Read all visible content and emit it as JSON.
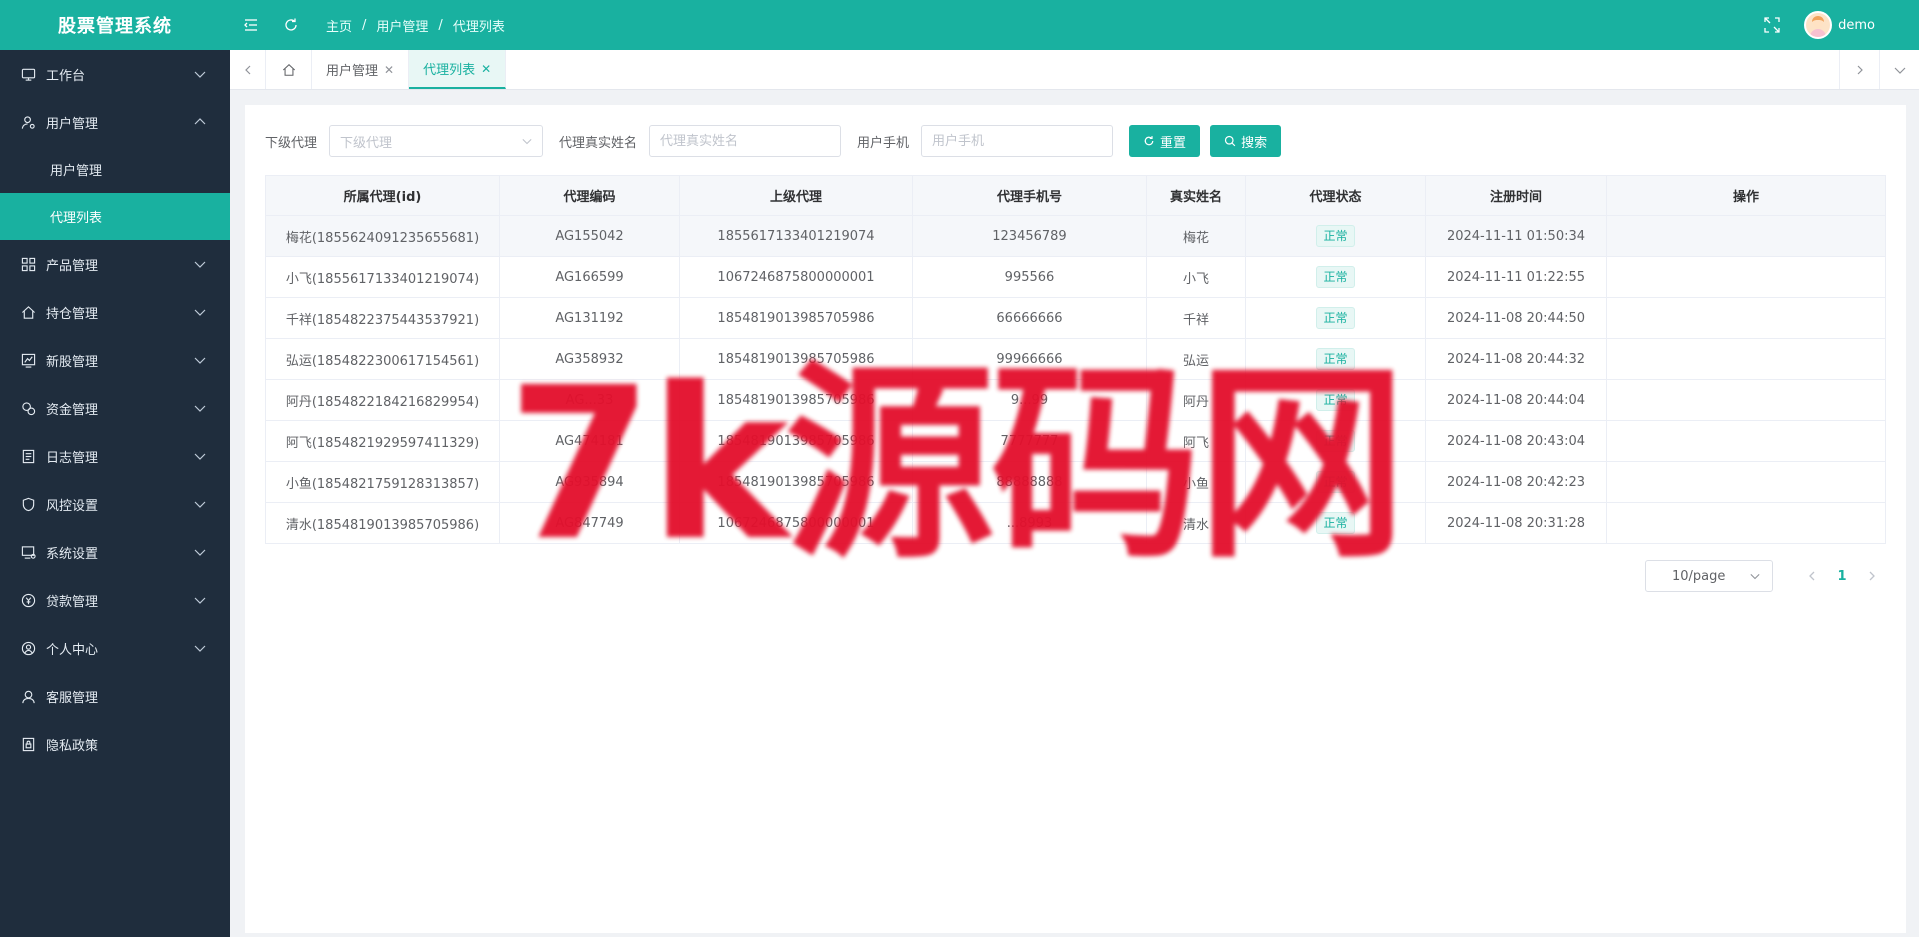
{
  "header": {
    "logo": "股票管理系统",
    "breadcrumb": [
      "主页",
      "用户管理",
      "代理列表"
    ],
    "username": "demo"
  },
  "sidebar": {
    "items": [
      {
        "label": "工作台",
        "icon": "monitor-icon",
        "expanded": false
      },
      {
        "label": "用户管理",
        "icon": "user-gear-icon",
        "expanded": true,
        "children": [
          {
            "label": "用户管理",
            "active": false
          },
          {
            "label": "代理列表",
            "active": true
          }
        ]
      },
      {
        "label": "产品管理",
        "icon": "grid-icon",
        "expanded": false
      },
      {
        "label": "持仓管理",
        "icon": "house-icon",
        "expanded": false
      },
      {
        "label": "新股管理",
        "icon": "chart-board-icon",
        "expanded": false
      },
      {
        "label": "资金管理",
        "icon": "money-icon",
        "expanded": false
      },
      {
        "label": "日志管理",
        "icon": "log-icon",
        "expanded": false
      },
      {
        "label": "风控设置",
        "icon": "shield-icon",
        "expanded": false
      },
      {
        "label": "系统设置",
        "icon": "settings-monitor-icon",
        "expanded": false
      },
      {
        "label": "贷款管理",
        "icon": "coin-icon",
        "expanded": false
      },
      {
        "label": "个人中心",
        "icon": "user-circle-icon",
        "expanded": false
      },
      {
        "label": "客服管理",
        "icon": "headset-icon",
        "hasArrow": false
      },
      {
        "label": "隐私政策",
        "icon": "lock-doc-icon",
        "hasArrow": false
      }
    ]
  },
  "tabs": [
    {
      "label": "用户管理",
      "active": false
    },
    {
      "label": "代理列表",
      "active": true
    }
  ],
  "filters": {
    "sub_agent_label": "下级代理",
    "sub_agent_placeholder": "下级代理",
    "real_name_label": "代理真实姓名",
    "real_name_placeholder": "代理真实姓名",
    "phone_label": "用户手机",
    "phone_placeholder": "用户手机",
    "reset_label": "重置",
    "search_label": "搜索"
  },
  "table": {
    "columns": [
      "所属代理(id)",
      "代理编码",
      "上级代理",
      "代理手机号",
      "真实姓名",
      "代理状态",
      "注册时间",
      "操作"
    ],
    "rows": [
      [
        "梅花(1855624091235655681)",
        "AG155042",
        "1855617133401219074",
        "123456789",
        "梅花",
        "正常",
        "2024-11-11 01:50:34",
        ""
      ],
      [
        "小飞(1855617133401219074)",
        "AG166599",
        "1067246875800000001",
        "995566",
        "小飞",
        "正常",
        "2024-11-11 01:22:55",
        ""
      ],
      [
        "千祥(1854822375443537921)",
        "AG131192",
        "1854819013985705986",
        "66666666",
        "千祥",
        "正常",
        "2024-11-08 20:44:50",
        ""
      ],
      [
        "弘运(1854822300617154561)",
        "AG358932",
        "1854819013985705986",
        "99966666",
        "弘运",
        "正常",
        "2024-11-08 20:44:32",
        ""
      ],
      [
        "阿丹(1854822184216829954)",
        "AG...33",
        "1854819013985705986",
        "9...99",
        "阿丹",
        "正常",
        "2024-11-08 20:44:04",
        ""
      ],
      [
        "阿飞(1854821929597411329)",
        "AG474181",
        "1854819013985705986",
        "7777777",
        "阿飞",
        "正常",
        "2024-11-08 20:43:04",
        ""
      ],
      [
        "小鱼(1854821759128313857)",
        "AG935894",
        "1854819013985705986",
        "88888888",
        "小鱼",
        "正常",
        "2024-11-08 20:42:23",
        ""
      ],
      [
        "清水(1854819013985705986)",
        "AG847749",
        "1067246875800000001",
        "...8993",
        "清水",
        "正常",
        "2024-11-08 20:31:28",
        ""
      ]
    ]
  },
  "pagination": {
    "page_size": "10/page",
    "current_page": "1"
  },
  "watermark": "7k源码网",
  "colors": {
    "primary": "#19b1a0",
    "sidebar_bg": "#1f2d3d",
    "watermark": "#e3102d"
  }
}
